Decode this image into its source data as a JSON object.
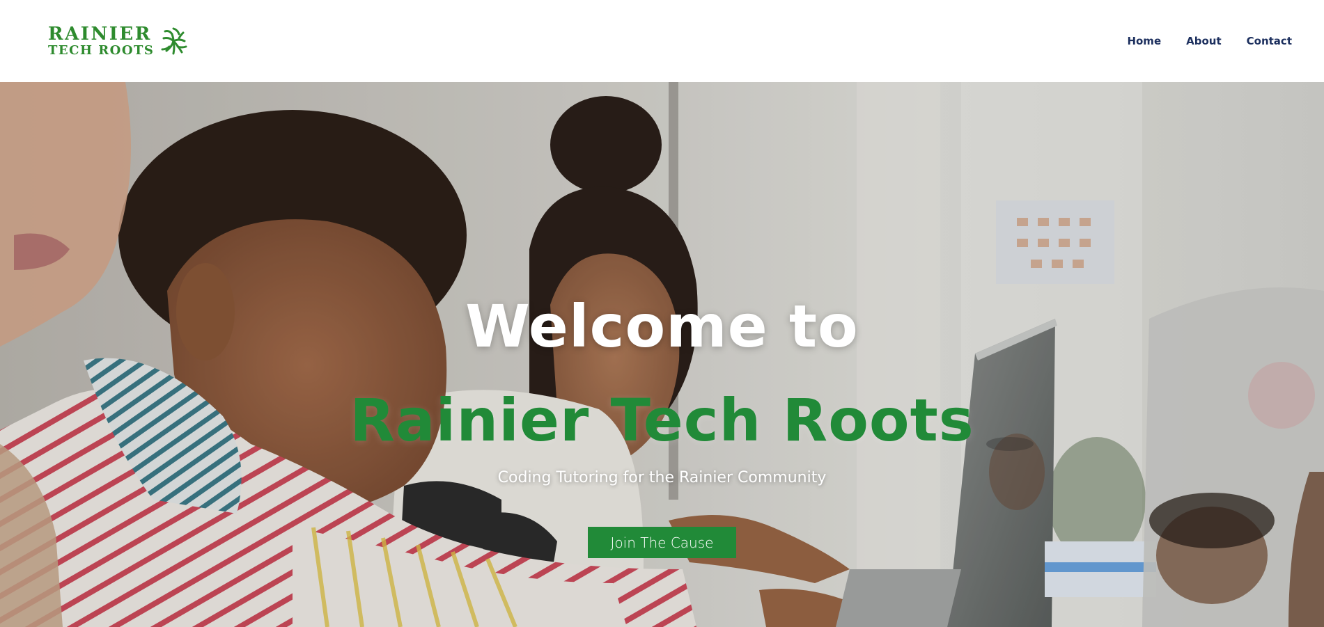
{
  "header": {
    "logo": {
      "line1": "RAINIER",
      "line2": "TECH ROOTS",
      "icon": "tree-roots-icon",
      "color": "#2e8b2e"
    },
    "nav": [
      {
        "label": "Home"
      },
      {
        "label": "About"
      },
      {
        "label": "Contact"
      }
    ],
    "nav_color": "#1c2f5e"
  },
  "hero": {
    "welcome": "Welcome to",
    "brand": "Rainier Tech Roots",
    "tagline": "Coding Tutoring for the Rainier Community",
    "cta_label": "Join The Cause",
    "accent_color": "#218a38"
  }
}
